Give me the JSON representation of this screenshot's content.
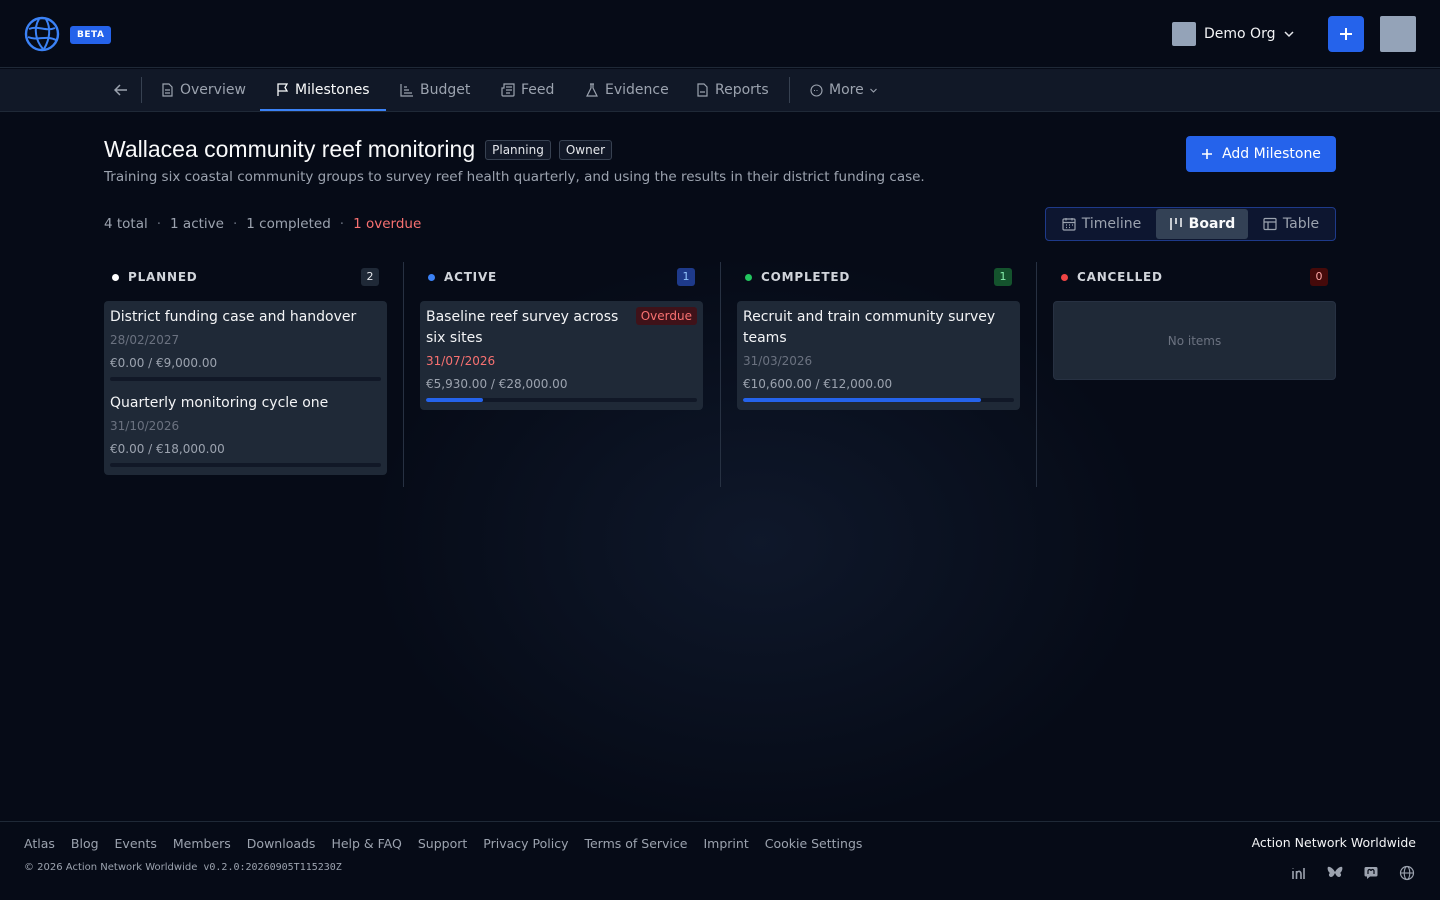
{
  "header": {
    "beta_label": "BETA",
    "org_name": "Demo Org"
  },
  "nav": {
    "tabs": [
      {
        "label": "Overview",
        "icon": "document-icon"
      },
      {
        "label": "Milestones",
        "icon": "flag-icon",
        "active": true
      },
      {
        "label": "Budget",
        "icon": "chart-icon"
      },
      {
        "label": "Feed",
        "icon": "newspaper-icon"
      },
      {
        "label": "Evidence",
        "icon": "flask-icon"
      },
      {
        "label": "Reports",
        "icon": "report-icon"
      },
      {
        "label": "More",
        "icon": "more-icon"
      }
    ]
  },
  "project": {
    "title": "Wallacea community reef monitoring",
    "status_badge": "Planning",
    "role_badge": "Owner",
    "description": "Training six coastal community groups to survey reef health quarterly, and using the results in their district funding case."
  },
  "actions": {
    "add_milestone": "Add Milestone"
  },
  "stats": {
    "total": "4 total",
    "active": "1 active",
    "completed": "1 completed",
    "overdue": "1 overdue"
  },
  "views": {
    "timeline": "Timeline",
    "board": "Board",
    "table": "Table",
    "selected": "Board"
  },
  "board": {
    "columns": [
      {
        "title": "PLANNED",
        "count": "2",
        "dot_color": "#ffffff",
        "cards": [
          {
            "title": "District funding case and handover",
            "date": "28/02/2027",
            "money": "€0.00 / €9,000.00",
            "progress": 0
          },
          {
            "title": "Quarterly monitoring cycle one",
            "date": "31/10/2026",
            "money": "€0.00 / €18,000.00",
            "progress": 0
          }
        ]
      },
      {
        "title": "ACTIVE",
        "count": "1",
        "dot_color": "#3b82f6",
        "cards": [
          {
            "title": "Baseline reef survey across six sites",
            "date": "31/07/2026",
            "money": "€5,930.00 / €28,000.00",
            "progress": 0.21,
            "tag": "Overdue"
          }
        ]
      },
      {
        "title": "COMPLETED",
        "count": "1",
        "dot_color": "#22c55e",
        "cards": [
          {
            "title": "Recruit and train community survey teams",
            "date": "31/03/2026",
            "money": "€10,600.00 / €12,000.00",
            "progress": 0.88
          }
        ]
      },
      {
        "title": "CANCELLED",
        "count": "0",
        "dot_color": "#ef4444",
        "empty_text": "No items"
      }
    ]
  },
  "footer": {
    "links": [
      "Atlas",
      "Blog",
      "Events",
      "Members",
      "Downloads",
      "Help & FAQ",
      "Support",
      "Privacy Policy",
      "Terms of Service",
      "Imprint",
      "Cookie Settings"
    ],
    "copyright": "© 2026 Action Network Worldwide",
    "version": "v0.2.0:20260905T115230Z",
    "brand": "Action Network Worldwide",
    "social_icons": [
      "linkedin-icon",
      "bluesky-icon",
      "mastodon-icon",
      "globe-icon"
    ]
  }
}
